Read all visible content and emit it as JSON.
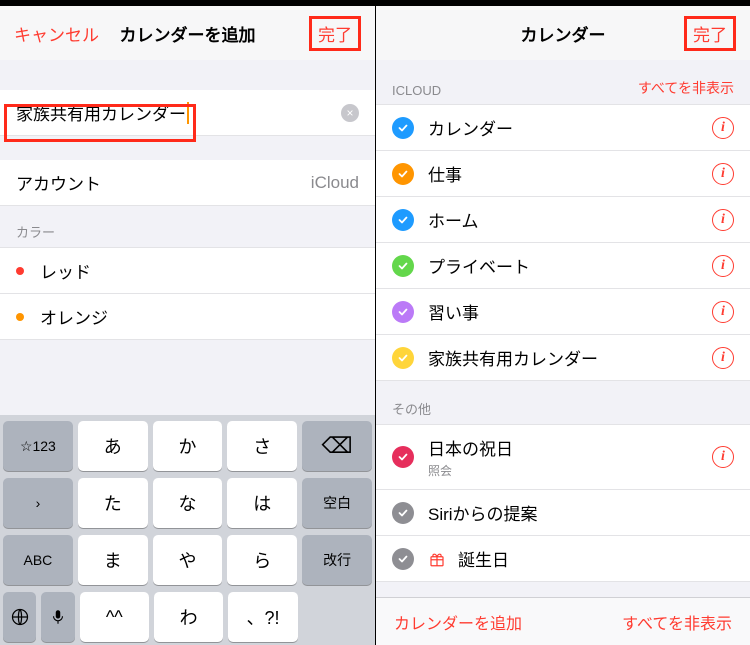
{
  "left": {
    "nav": {
      "cancel": "キャンセル",
      "title": "カレンダーを追加",
      "done": "完了"
    },
    "input": {
      "value": "家族共有用カレンダー",
      "clear_icon": "×"
    },
    "account": {
      "label": "アカウント",
      "value": "iCloud"
    },
    "color_section": "カラー",
    "colors": [
      {
        "name": "レッド",
        "hex": "#ff3b30"
      },
      {
        "name": "オレンジ",
        "hex": "#ff9500"
      }
    ],
    "keyboard": {
      "row1": [
        "☆123",
        "あ",
        "か",
        "さ"
      ],
      "row2": [
        "た",
        "な",
        "は"
      ],
      "row3": [
        "ABC",
        "ま",
        "や",
        "ら"
      ],
      "row4": [
        "^^",
        "わ",
        "、?!"
      ],
      "backspace": "⌫",
      "space": "空白",
      "return": "改行",
      "globe": "🌐",
      "mic": "🎤",
      "chevron": "›"
    }
  },
  "right": {
    "nav": {
      "title": "カレンダー",
      "done": "完了"
    },
    "icloud_header": "ICLOUD",
    "hide_all": "すべてを非表示",
    "calendars": [
      {
        "name": "カレンダー",
        "color": "#1e9bff"
      },
      {
        "name": "仕事",
        "color": "#ff9500"
      },
      {
        "name": "ホーム",
        "color": "#1e9bff"
      },
      {
        "name": "プライベート",
        "color": "#63d74b"
      },
      {
        "name": "習い事",
        "color": "#bb7af7"
      },
      {
        "name": "家族共有用カレンダー",
        "color": "#ffd53a"
      }
    ],
    "other_header": "その他",
    "other": [
      {
        "name": "日本の祝日",
        "sub": "照会",
        "color": "#e62e5c",
        "info": true
      },
      {
        "name": "Siriからの提案",
        "color": "#8e8e93",
        "info": false
      },
      {
        "name": "誕生日",
        "color": "#8e8e93",
        "info": false,
        "gift": true
      }
    ],
    "toolbar": {
      "add": "カレンダーを追加",
      "hide": "すべてを非表示"
    }
  }
}
